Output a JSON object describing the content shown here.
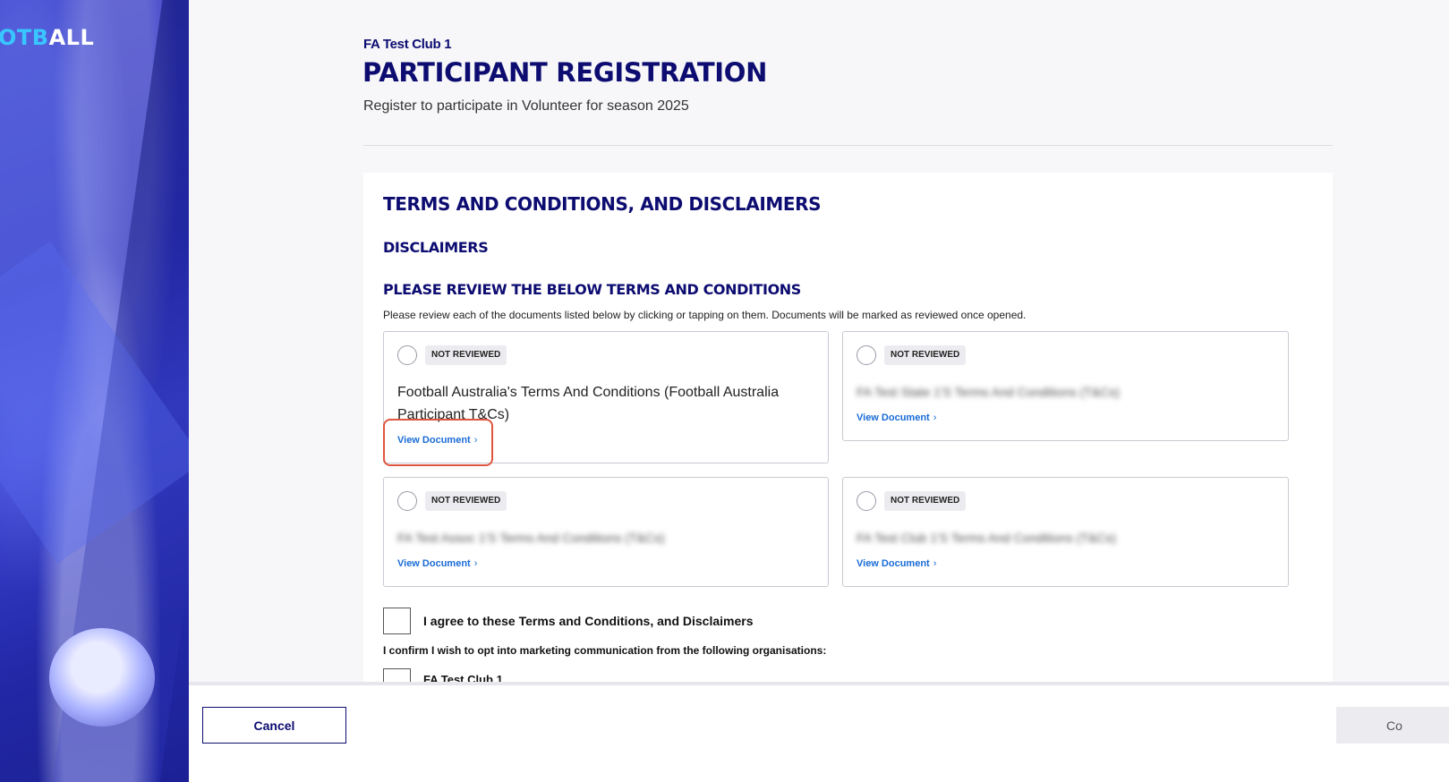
{
  "brand": {
    "logo_part1": "OTB",
    "logo_part2": "ALL"
  },
  "header": {
    "club_name": "FA Test Club 1",
    "title": "PARTICIPANT REGISTRATION",
    "subtitle": "Register to participate in Volunteer for season 2025"
  },
  "section": {
    "title": "TERMS AND CONDITIONS, AND DISCLAIMERS",
    "disclaimers_heading": "DISCLAIMERS",
    "review_heading": "PLEASE REVIEW THE BELOW TERMS AND CONDITIONS",
    "instructions": "Please review each of the documents listed below by clicking or tapping on them. Documents will be marked as reviewed once opened."
  },
  "documents": [
    {
      "status": "NOT REVIEWED",
      "title": "Football Australia's Terms And Conditions (Football Australia Participant T&Cs)",
      "view_label": "View Document"
    },
    {
      "status": "NOT REVIEWED",
      "title": "FA Test State 1'S Terms And Conditions (T&Cs)",
      "view_label": "View Document"
    },
    {
      "status": "NOT REVIEWED",
      "title": "FA Test Assoc 1'S Terms And Conditions (T&Cs)",
      "view_label": "View Document"
    },
    {
      "status": "NOT REVIEWED",
      "title": "FA Test Club 1'S Terms And Conditions (T&Cs)",
      "view_label": "View Document"
    }
  ],
  "agree": {
    "label": "I agree to these Terms and Conditions, and Disclaimers"
  },
  "marketing": {
    "label": "I confirm I wish to opt into marketing communication from the following organisations:",
    "first_org": "FA Test Club 1"
  },
  "footer": {
    "cancel_label": "Cancel",
    "continue_label": "Co"
  },
  "colors": {
    "navy": "#0d0c71",
    "link": "#1a6cd6",
    "highlight": "#e05540",
    "hero": "#2a2fbf",
    "logo_accent": "#39c6ff"
  },
  "icons": {
    "chevron": "chevron-right-icon",
    "radio": "radio-circle-icon"
  }
}
